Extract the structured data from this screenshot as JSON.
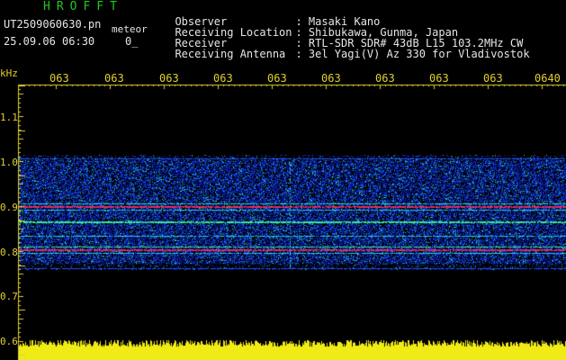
{
  "header": {
    "app_title": "HROFFT",
    "file_name": "UT2509060630.pn",
    "meteor_label": "meteor",
    "date_time": "25.09.06 06:30",
    "count_label": "0_"
  },
  "info": [
    {
      "key": "Observer",
      "value": ": Masaki Kano"
    },
    {
      "key": "Receiving Location",
      "value": ": Shibukawa, Gunma, Japan"
    },
    {
      "key": "Receiver",
      "value": ": RTL-SDR SDR# 43dB L15 103.2MHz CW"
    },
    {
      "key": "Receiving Antenna",
      "value": ": 3el Yagi(V) Az 330 for Vladivostok"
    }
  ],
  "axis": {
    "unit": "kHz",
    "time_labels": [
      "063",
      "063",
      "063",
      "063",
      "063",
      "063",
      "063",
      "063",
      "063",
      "0640"
    ],
    "freq_labels": [
      "1.1",
      "1.0",
      "0.9",
      "0.8",
      "0.7",
      "0.6"
    ]
  },
  "colors": {
    "header_green": "#21c821",
    "label_yellow": "#e0d030",
    "text_white": "#e6e6e6",
    "background": "#000000"
  }
}
